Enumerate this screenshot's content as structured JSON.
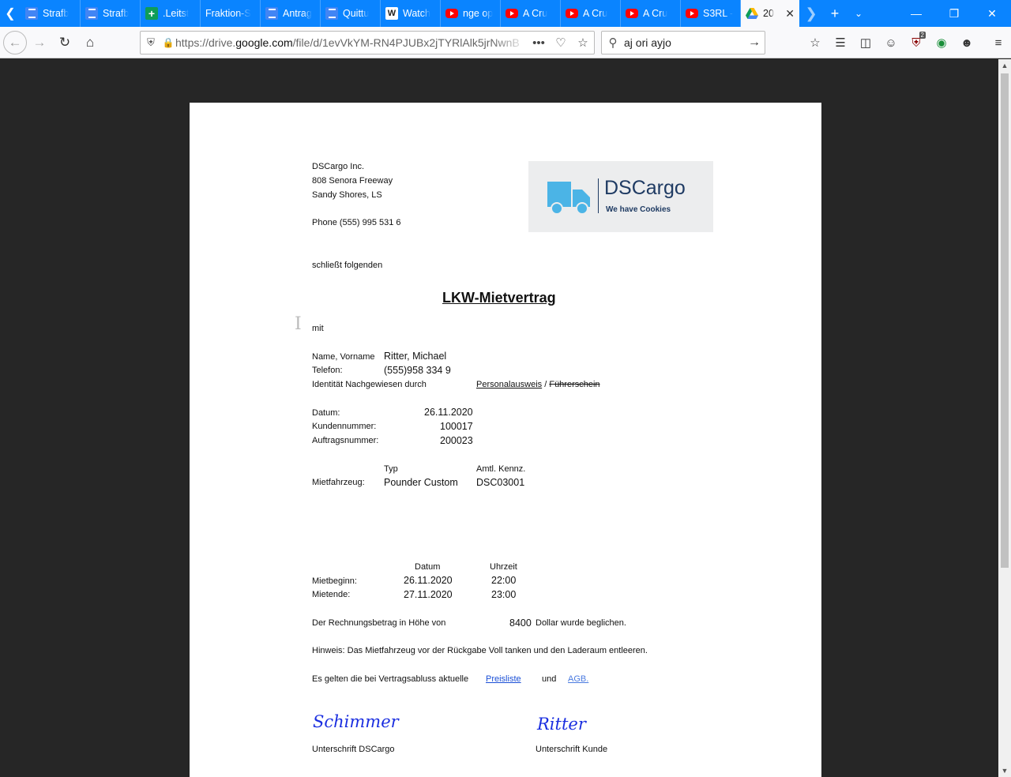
{
  "tabs": [
    {
      "icon": "docs",
      "label": "Strafb"
    },
    {
      "icon": "docs",
      "label": "Strafb"
    },
    {
      "icon": "sheets",
      "label": ".Leitst"
    },
    {
      "icon": "none",
      "label": "Fraktion-S"
    },
    {
      "icon": "docs",
      "label": "Antrag"
    },
    {
      "icon": "docs",
      "label": "Quittu"
    },
    {
      "icon": "w",
      "label": "Watch"
    },
    {
      "icon": "youtube",
      "label": "nge op"
    },
    {
      "icon": "youtube",
      "label": "A Cru"
    },
    {
      "icon": "youtube",
      "label": "A Cru"
    },
    {
      "icon": "youtube",
      "label": "A Cru"
    },
    {
      "icon": "youtube",
      "label": "S3RL -"
    },
    {
      "icon": "drive",
      "label": "20",
      "active": true
    }
  ],
  "nav": {
    "url_prefix": "https://drive.",
    "url_domain": "google.com",
    "url_path": "/file/d/1evVkYM-RN4PJUBx2jTYRlAlk5jrNwnB",
    "search_value": "aj ori ayjo"
  },
  "doc": {
    "company": "DSCargo Inc.",
    "street": "808 Senora Freeway",
    "city": "Sandy Shores, LS",
    "phone": "Phone (555) 995 531 6",
    "logo_brand": "DSCargo",
    "logo_tagline": "We have Cookies",
    "intro": "schließt folgenden",
    "title": "LKW-Mietvertrag",
    "with": "mit",
    "name_label": "Name, Vorname",
    "name_value": "Ritter, Michael",
    "phone_label": "Telefon:",
    "phone_value": "(555)958 334 9",
    "id_label": "Identität Nachgewiesen durch",
    "id_option1": "Personalausweis",
    "id_sep": "/",
    "id_option2": "Führerschein",
    "date_label": "Datum:",
    "date_value": "26.11.2020",
    "customer_label": "Kundennummer:",
    "customer_value": "100017",
    "order_label": "Auftragsnummer:",
    "order_value": "200023",
    "vehicle_type_header": "Typ",
    "vehicle_plate_header": "Amtl. Kennz.",
    "vehicle_label": "Mietfahrzeug:",
    "vehicle_type": "Pounder Custom",
    "vehicle_plate": "DSC03001",
    "rent_date_header": "Datum",
    "rent_time_header": "Uhrzeit",
    "rent_start_label": "Mietbeginn:",
    "rent_start_date": "26.11.2020",
    "rent_start_time": "22:00",
    "rent_end_label": "Mietende:",
    "rent_end_date": "27.11.2020",
    "rent_end_time": "23:00",
    "invoice_text": "Der Rechnungsbetrag in Höhe von",
    "invoice_amount": "8400",
    "invoice_suffix": "Dollar wurde beglichen.",
    "hint": "Hinweis: Das Mietfahrzeug vor der Rückgabe Voll tanken und den Laderaum entleeren.",
    "terms_text": "Es gelten die bei Vertragsabluss aktuelle",
    "terms_link1": "Preisliste",
    "terms_and": "und",
    "terms_link2": "AGB.",
    "sig_company": "Schimmer",
    "sig_customer": "Ritter",
    "sig_company_label": "Unterschrift DSCargo",
    "sig_customer_label": "Unterschrift Kunde"
  },
  "colors": {
    "tabbar": "#0a84ff",
    "viewer_bg": "#262626",
    "logo_text": "#1f3b63",
    "logo_truck": "#4bb4e6",
    "signature": "#1a2ee0",
    "link": "#1a4fd6"
  }
}
